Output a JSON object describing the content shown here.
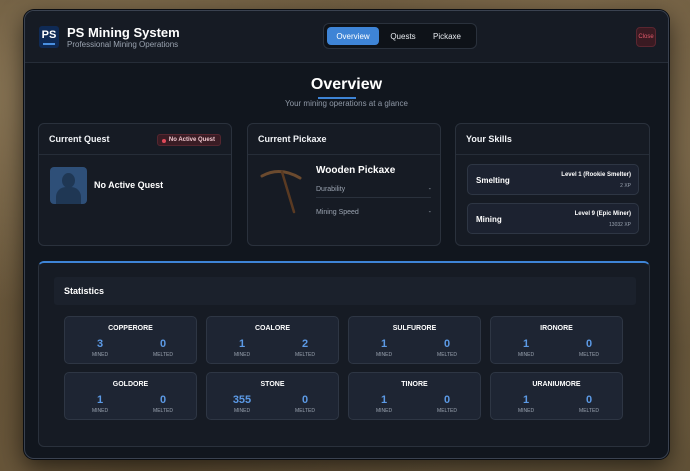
{
  "app": {
    "title": "PS Mining System",
    "subtitle": "Professional Mining Operations",
    "logo_text": "PS",
    "close_label": "Close"
  },
  "tabs": [
    {
      "label": "Overview",
      "active": true
    },
    {
      "label": "Quests",
      "active": false
    },
    {
      "label": "Pickaxe",
      "active": false
    }
  ],
  "overview": {
    "title": "Overview",
    "subtitle": "Your mining operations at a glance"
  },
  "quest": {
    "header": "Current Quest",
    "badge": "No Active Quest",
    "text": "No Active Quest"
  },
  "pickaxe": {
    "header": "Current Pickaxe",
    "name": "Wooden Pickaxe",
    "rows": [
      {
        "label": "Durability",
        "value": "-"
      },
      {
        "label": "Mining Speed",
        "value": "-"
      }
    ]
  },
  "skills": {
    "header": "Your Skills",
    "items": [
      {
        "name": "Smelting",
        "level": "Level 1 (Rookie Smelter)",
        "xp": "2 XP"
      },
      {
        "name": "Mining",
        "level": "Level 9 (Epic Miner)",
        "xp": "13032 XP"
      }
    ]
  },
  "statistics": {
    "header": "Statistics",
    "mined_label": "MINED",
    "melted_label": "MELTED",
    "ores": [
      {
        "name": "COPPERORE",
        "mined": "3",
        "melted": "0"
      },
      {
        "name": "COALORE",
        "mined": "1",
        "melted": "2"
      },
      {
        "name": "SULFURORE",
        "mined": "1",
        "melted": "0"
      },
      {
        "name": "IRONORE",
        "mined": "1",
        "melted": "0"
      },
      {
        "name": "GOLDORE",
        "mined": "1",
        "melted": "0"
      },
      {
        "name": "STONE",
        "mined": "355",
        "melted": "0"
      },
      {
        "name": "TINORE",
        "mined": "1",
        "melted": "0"
      },
      {
        "name": "URANIUMORE",
        "mined": "1",
        "melted": "0"
      }
    ]
  },
  "colors": {
    "accent": "#3e84d6",
    "danger": "#e04a5a",
    "panel": "#161b24"
  }
}
